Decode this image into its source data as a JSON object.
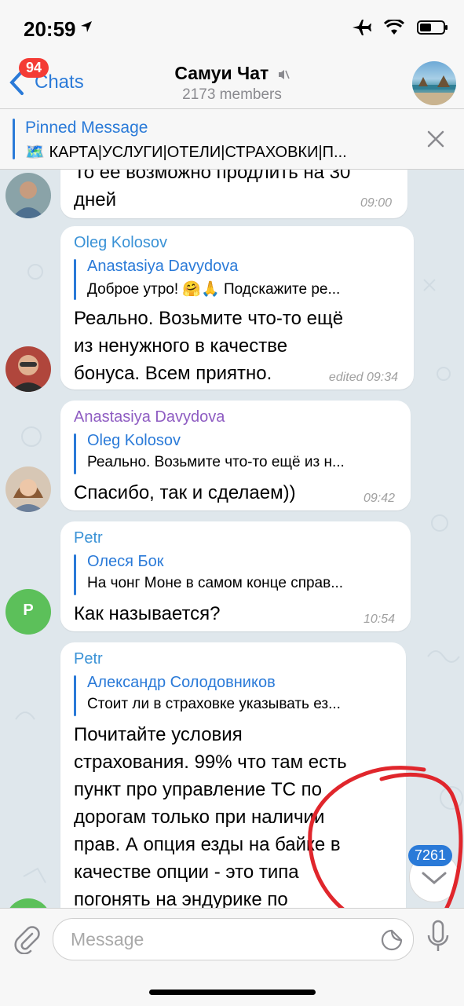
{
  "status_bar": {
    "time": "20:59"
  },
  "nav": {
    "back_label": "Chats",
    "unread_badge": "94",
    "title": "Самуи Чат",
    "subtitle": "2173 members"
  },
  "pinned": {
    "title": "Pinned Message",
    "text": "🗺️ КАРТА|УСЛУГИ|ОТЕЛИ|СТРАХОВКИ|П..."
  },
  "messages": [
    {
      "lines": [
        "То ее возможно продлить на 30",
        "дней"
      ],
      "time": "09:00"
    },
    {
      "sender": "Oleg Kolosov",
      "reply_name": "Anastasiya Davydova",
      "reply_text": "Доброе утро! 🤗🙏 Подскажите ре...",
      "lines": [
        "Реально. Возьмите что-то ещё",
        "из ненужного в качестве",
        "бонуса. Всем приятно."
      ],
      "time": "edited 09:34"
    },
    {
      "sender": "Anastasiya Davydova",
      "reply_name": "Oleg Kolosov",
      "reply_text": "Реально. Возьмите что-то ещё из н...",
      "lines": [
        "Спасибо, так и сделаем))"
      ],
      "time": "09:42"
    },
    {
      "sender": "Petr",
      "avatar_letter": "P",
      "reply_name": "Олеся Бок",
      "reply_text": "На чонг Моне в самом конце справ...",
      "lines": [
        "Как называется?"
      ],
      "time": "10:54"
    },
    {
      "sender": "Petr",
      "reply_name": "Александр Солодовников",
      "reply_text": "Стоит ли в страховке указывать ез...",
      "lines": [
        "Почитайте условия",
        "страхования. 99% что там есть",
        "пункт про управление ТС по",
        "дорогам только при наличии",
        "прав.   А опция езды на байке в",
        "качестве опции - это типа",
        "погонять на эндурике по"
      ]
    }
  ],
  "scroll_badge": "7261",
  "composer": {
    "placeholder": "Message"
  },
  "colors": {
    "accent": "#2a7ad8",
    "badge": "#f43b35",
    "sender_oleg": "#3a92d6",
    "sender_anastasiya": "#8e5cc2",
    "sender_petr": "#3a92d6",
    "annotation": "#e0262c"
  }
}
